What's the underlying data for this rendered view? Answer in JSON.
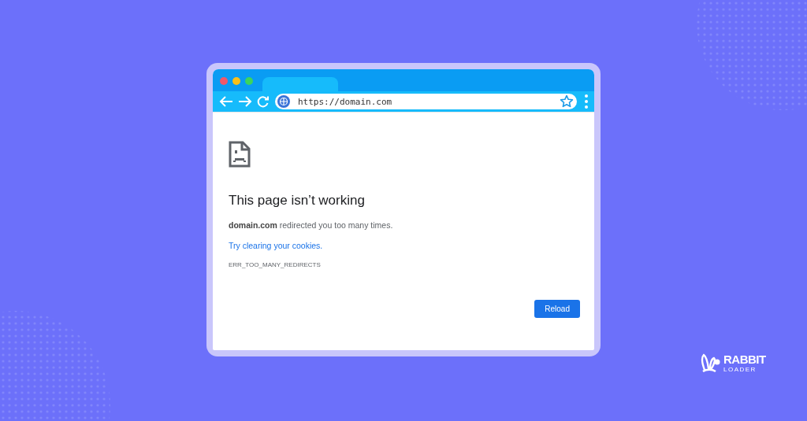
{
  "browser": {
    "address": "https://domain.com"
  },
  "error_page": {
    "heading": "This page isn’t working",
    "message": "**domain.com** redirected you too many times.",
    "link": "Try clearing your cookies.",
    "code": "ERR_TOO_MANY_REDIRECTS",
    "button": "Reload"
  },
  "logo": {
    "line_1": "RABBIT",
    "line_2": "LOADER"
  }
}
